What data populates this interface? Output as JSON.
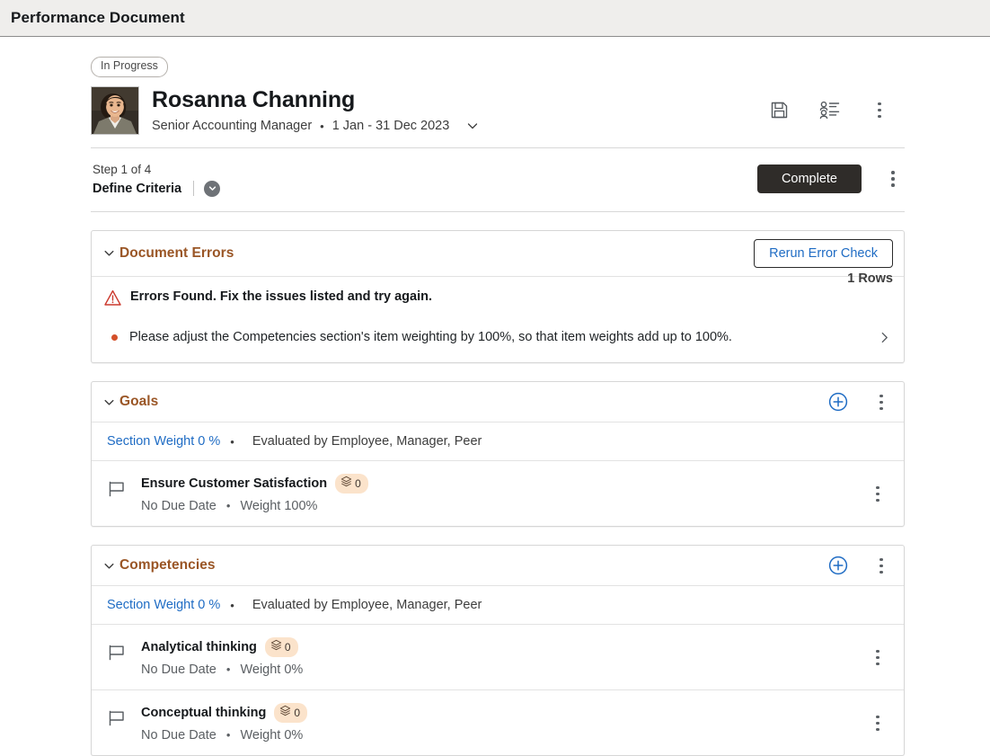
{
  "titlebar": {
    "title": "Performance Document"
  },
  "employee": {
    "status_badge": "In Progress",
    "name": "Rosanna Channing",
    "job_title": "Senior Accounting Manager",
    "separator": "•",
    "period": "1 Jan - 31 Dec 2023",
    "avatar_alt": "employee-photo",
    "actions": {
      "save": "save-icon",
      "participants": "participant-list-icon",
      "more": "more-options-icon"
    }
  },
  "step": {
    "count_label": "Step 1 of 4",
    "name": "Define Criteria",
    "expand_icon": "chevron-down-circle-icon",
    "complete_button": "Complete",
    "more": "more-options-icon"
  },
  "document_errors": {
    "title": "Document Errors",
    "rerun_button": "Rerun Error Check",
    "rows_label": "1 Rows",
    "summary": "Errors Found.  Fix the issues listed and try again.",
    "items": [
      "Please adjust the Competencies section's item weighting by 100%, so that item weights add up to 100%."
    ]
  },
  "sections": [
    {
      "title": "Goals",
      "section_weight": "Section Weight 0 %",
      "separator": "•",
      "evaluated_by": "Evaluated by Employee, Manager, Peer",
      "add_label": "add-icon",
      "items": [
        {
          "title": "Ensure Customer Satisfaction",
          "badge_count": "0",
          "due": "No Due Date",
          "separator": "•",
          "weight": "Weight 100%"
        }
      ]
    },
    {
      "title": "Competencies",
      "section_weight": "Section Weight 0 %",
      "separator": "•",
      "evaluated_by": "Evaluated by Employee, Manager, Peer",
      "add_label": "add-icon",
      "items": [
        {
          "title": "Analytical thinking",
          "badge_count": "0",
          "due": "No Due Date",
          "separator": "•",
          "weight": "Weight 0%"
        },
        {
          "title": "Conceptual thinking",
          "badge_count": "0",
          "due": "No Due Date",
          "separator": "•",
          "weight": "Weight 0%"
        }
      ]
    }
  ],
  "colors": {
    "section_title": "#9a5626",
    "link": "#1f6cc4",
    "error": "#cc3a2e",
    "badge_bg": "#fbe3cb",
    "complete_btn": "#2f2c29"
  }
}
